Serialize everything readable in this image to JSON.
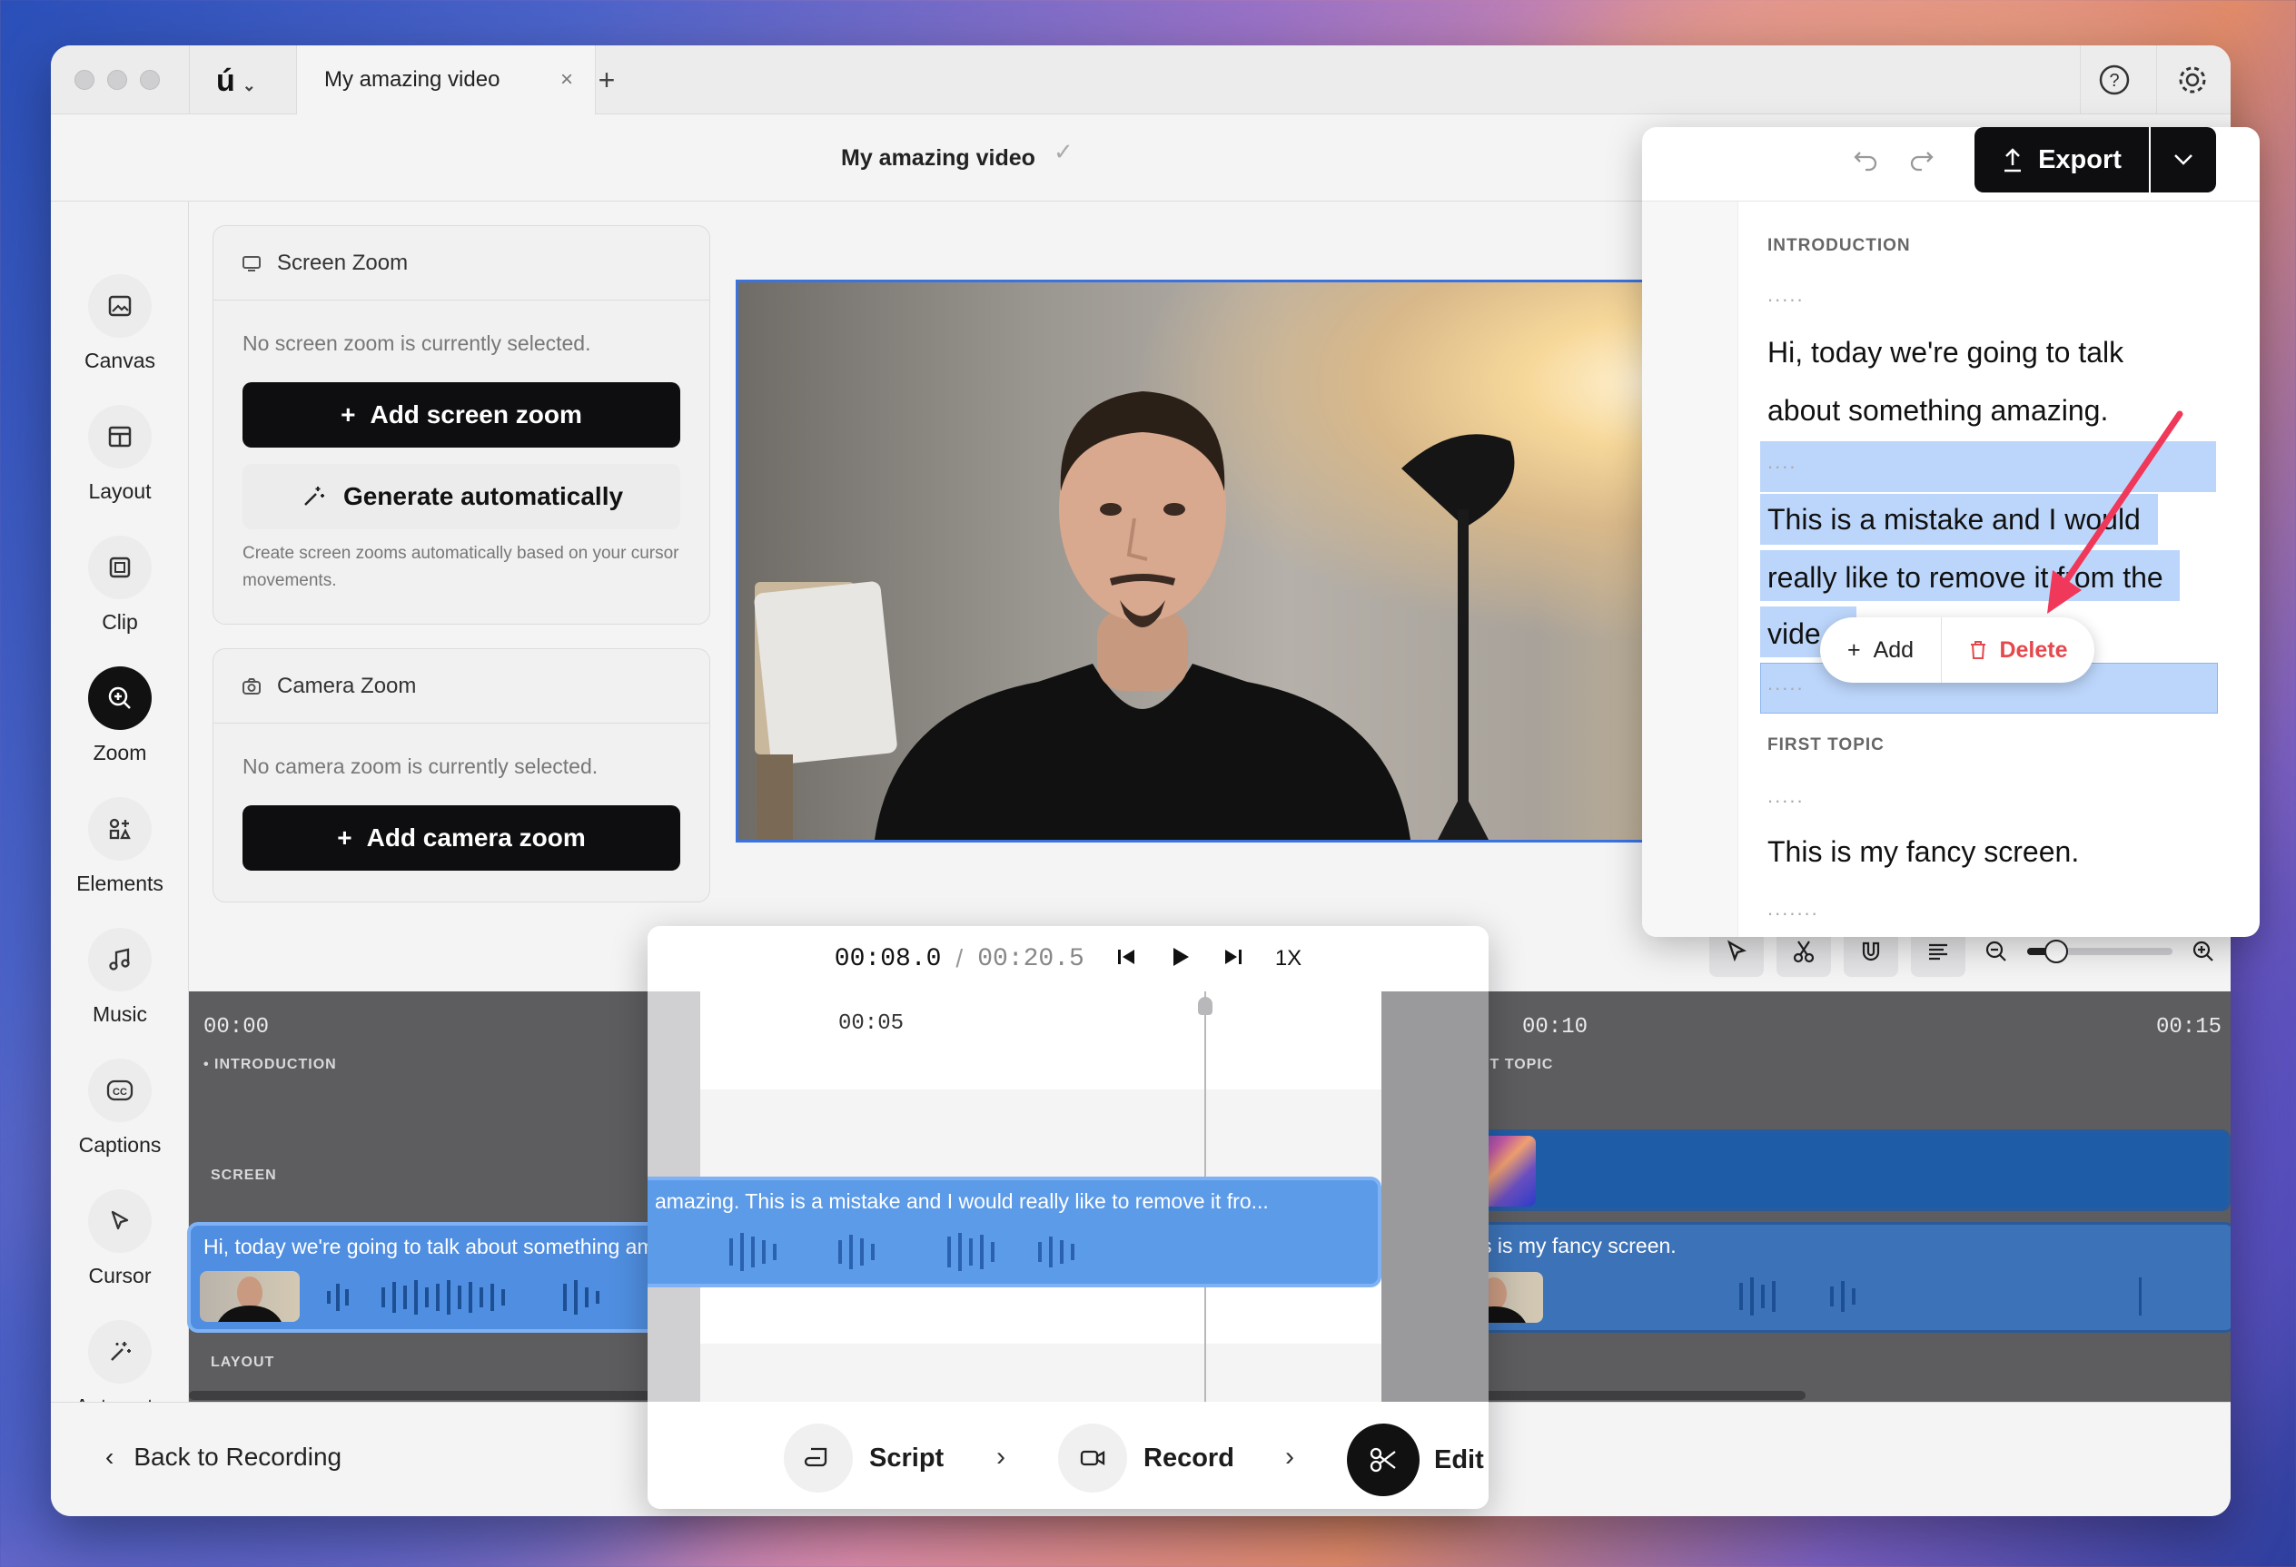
{
  "app": {
    "logo": "ú",
    "tab_title": "My amazing video",
    "doc_title": "My amazing video"
  },
  "sidebar": {
    "items": [
      {
        "label": "Canvas",
        "icon": "image-icon"
      },
      {
        "label": "Layout",
        "icon": "layout-icon"
      },
      {
        "label": "Clip",
        "icon": "clip-icon"
      },
      {
        "label": "Zoom",
        "icon": "zoom-icon",
        "active": true
      },
      {
        "label": "Elements",
        "icon": "elements-icon"
      },
      {
        "label": "Music",
        "icon": "music-icon"
      },
      {
        "label": "Captions",
        "icon": "captions-icon"
      },
      {
        "label": "Cursor",
        "icon": "cursor-icon"
      },
      {
        "label": "Automate",
        "icon": "wand-icon"
      }
    ]
  },
  "screen_zoom": {
    "title": "Screen Zoom",
    "empty_text": "No screen zoom is currently selected.",
    "add_label": "Add screen zoom",
    "generate_label": "Generate automatically",
    "help_text": "Create screen zooms automatically based on your cursor movements."
  },
  "camera_zoom": {
    "title": "Camera Zoom",
    "empty_text": "No camera zoom is currently selected.",
    "add_label": "Add camera zoom"
  },
  "export": {
    "label": "Export"
  },
  "script": {
    "section1": "INTRODUCTION",
    "line1": "Hi, today we're going to talk",
    "line2": "about something amazing.",
    "line3": "This is a mistake and I would",
    "line4": "really like to remove it from the",
    "line5": "vide",
    "section2": "FIRST TOPIC",
    "line6": "This is my fancy screen.",
    "dots1": ".....",
    "dots2": "....",
    "dots3": ".....",
    "dots4": ".....",
    "dots5": "......."
  },
  "context_menu": {
    "add_label": "Add",
    "delete_label": "Delete",
    "delete_color": "#e5484d"
  },
  "playback": {
    "current": "00:08.0",
    "separator": "/",
    "total": "00:20.5",
    "speed": "1X"
  },
  "timeline": {
    "ticks": [
      "00:00",
      "00:05",
      "00:10",
      "00:15"
    ],
    "marker_intro": "INTRODUCTION",
    "marker_first": "FIRST TOPIC",
    "track_screen": "SCREEN",
    "track_layout": "LAYOUT",
    "clip1_text": "Hi, today we're going to talk about something amazing. This is a mistake and I would really like to remove it fro...",
    "clip2_text": "This is my fancy screen.",
    "zoom_level": 0.2
  },
  "footer": {
    "back_label": "Back to Recording",
    "steps": [
      {
        "label": "Script",
        "icon": "script-icon"
      },
      {
        "label": "Record",
        "icon": "camera-icon"
      },
      {
        "label": "Edit",
        "icon": "scissors-icon",
        "active": true
      }
    ]
  },
  "colors": {
    "accent": "#3a73e0",
    "highlight": "#bcd6fb",
    "clip": "#3c73b8",
    "arrow": "#f0385a"
  }
}
